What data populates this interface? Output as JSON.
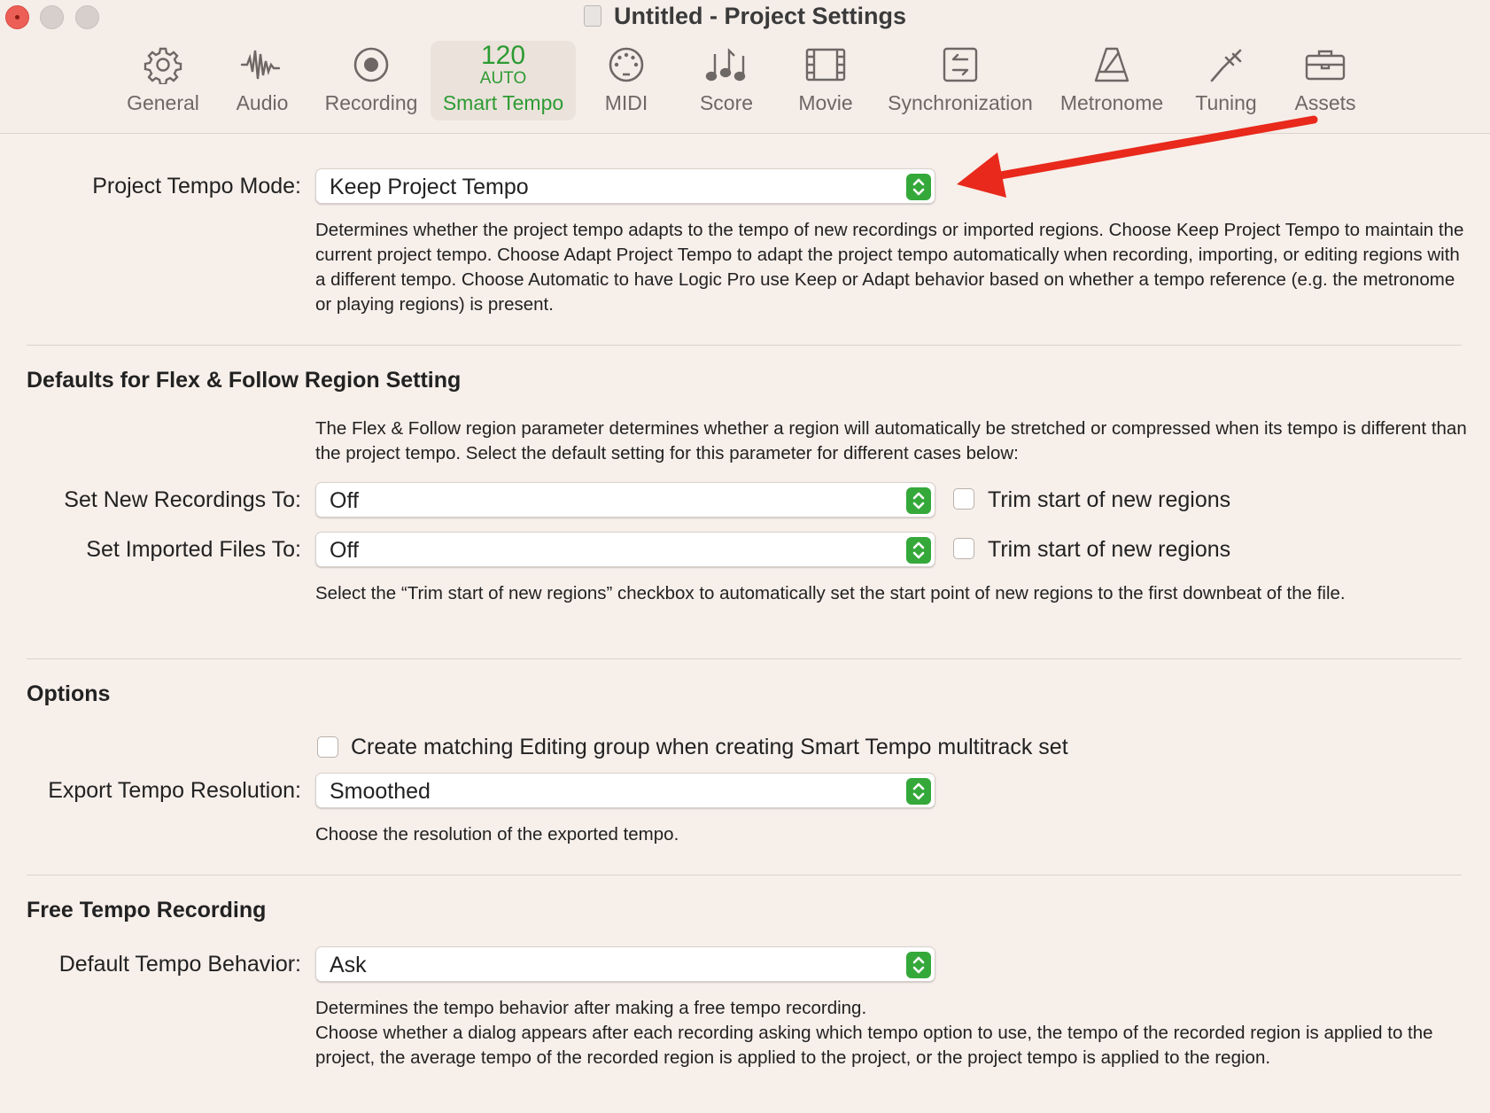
{
  "window": {
    "title": "Untitled - Project Settings"
  },
  "tabs": [
    {
      "label": "General",
      "icon": "gear-icon"
    },
    {
      "label": "Audio",
      "icon": "waveform-icon"
    },
    {
      "label": "Recording",
      "icon": "record-icon"
    },
    {
      "label": "Smart Tempo",
      "icon_number": "120",
      "icon_text": "AUTO",
      "selected": true
    },
    {
      "label": "MIDI",
      "icon": "midi-port-icon"
    },
    {
      "label": "Score",
      "icon": "music-notes-icon"
    },
    {
      "label": "Movie",
      "icon": "film-icon"
    },
    {
      "label": "Synchronization",
      "icon": "sync-icon"
    },
    {
      "label": "Metronome",
      "icon": "metronome-icon"
    },
    {
      "label": "Tuning",
      "icon": "tuning-fork-icon"
    },
    {
      "label": "Assets",
      "icon": "briefcase-icon"
    }
  ],
  "colors": {
    "accent": "#2d9b32",
    "background": "#f7efea",
    "annotation_arrow": "#e8291c"
  },
  "project_tempo": {
    "label": "Project Tempo Mode:",
    "value": "Keep Project Tempo",
    "description": "Determines whether the project tempo adapts to the tempo of new recordings or imported regions. Choose Keep Project Tempo to maintain the current project tempo. Choose Adapt Project Tempo to adapt the project tempo automatically when recording, importing, or editing regions with a different tempo. Choose Automatic to  have Logic Pro use Keep or Adapt behavior based on whether a tempo reference (e.g. the metronome or playing regions) is present."
  },
  "flex_follow": {
    "title": "Defaults for Flex & Follow Region Setting",
    "description": "The Flex & Follow region parameter determines whether a region will automatically be stretched or compressed when its tempo is different than the project tempo. Select the default setting for this parameter for different cases below:",
    "new_recordings": {
      "label": "Set New Recordings To:",
      "value": "Off",
      "checkbox_label": "Trim start of new regions",
      "checked": false
    },
    "imported_files": {
      "label": "Set Imported Files To:",
      "value": "Off",
      "checkbox_label": "Trim start of new regions",
      "checked": false
    },
    "note": "Select the “Trim start of new regions” checkbox to automatically set the start point of new regions to the first downbeat of the file."
  },
  "options": {
    "title": "Options",
    "editing_group": {
      "label": "Create matching Editing group when creating Smart Tempo multitrack set",
      "checked": false
    },
    "export_resolution": {
      "label": "Export Tempo Resolution:",
      "value": "Smoothed",
      "description": "Choose the resolution of the exported tempo."
    }
  },
  "free_tempo": {
    "title": "Free Tempo Recording",
    "default_behavior": {
      "label": "Default Tempo Behavior:",
      "value": "Ask"
    },
    "description_line1": "Determines the tempo behavior after making a free tempo recording.",
    "description_line2": "Choose whether a dialog appears after each recording asking which tempo option to use, the tempo of the recorded region is applied to the project, the average tempo of the recorded region is applied to the project, or the project tempo is applied to the region."
  }
}
